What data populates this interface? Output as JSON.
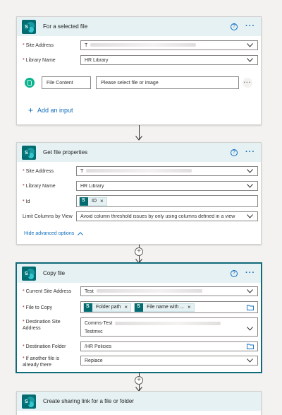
{
  "cards": {
    "trigger": {
      "title": "For a selected file",
      "site_label": "Site Address",
      "site_value": "T",
      "library_label": "Library Name",
      "library_value": "HR Library",
      "file_content_label": "File Content",
      "file_content_placeholder": "Please select file or image",
      "add_input_label": "Add an input"
    },
    "get_props": {
      "title": "Get file properties",
      "site_label": "Site Address",
      "site_value": "T",
      "library_label": "Library Name",
      "library_value": "HR Library",
      "id_label": "Id",
      "id_token": "ID",
      "limit_label": "Limit Columns by View",
      "limit_value": "Avoid column threshold issues by only using columns defined in a view",
      "advanced_label": "Hide advanced options"
    },
    "copy": {
      "title": "Copy file",
      "current_site_label": "Current Site Address",
      "current_site_value": "Test",
      "file_to_copy_label": "File to Copy",
      "file_token_1": "Folder path",
      "file_token_2": "File name with ...",
      "dest_site_label_1": "Destination Site",
      "dest_site_label_2": "Address",
      "dest_site_value_1": "Comms-Test",
      "dest_site_value_2": "Testmvc",
      "dest_folder_label": "Destination Folder",
      "dest_folder_value": "/HR Policies",
      "if_exists_label_1": "If another file is",
      "if_exists_label_2": "already there",
      "if_exists_value": "Replace"
    },
    "sharing": {
      "title": "Create sharing link for a file or folder"
    }
  },
  "icons": {
    "help": "?",
    "more": "···",
    "close": "×",
    "plus": "+",
    "chevron_up": "^"
  },
  "colors": {
    "header_bg": "#e5f1f3",
    "accent": "#0f6cbd",
    "required": "#a4262c",
    "sharepoint": "#036c70"
  }
}
